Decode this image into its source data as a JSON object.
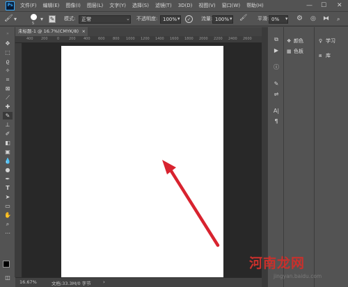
{
  "app": {
    "logo": "Ps"
  },
  "menu": [
    "文件(F)",
    "编辑(E)",
    "图像(I)",
    "图层(L)",
    "文字(Y)",
    "选择(S)",
    "滤镜(T)",
    "3D(D)",
    "视图(V)",
    "窗口(W)",
    "帮助(H)"
  ],
  "window_controls": {
    "minimize": "—",
    "maximize": "☐",
    "close": "✕"
  },
  "options": {
    "brush_size": "5",
    "mode_label": "模式:",
    "mode_value": "正常",
    "opacity_label": "不透明度:",
    "opacity_value": "100%",
    "flow_label": "流量:",
    "flow_value": "100%",
    "smooth_label": "平滑:",
    "smooth_value": "0%"
  },
  "document_tab": {
    "title": "未标题-1 @ 16.7%(CMYK/8)",
    "close": "×"
  },
  "ruler_ticks": [
    "400",
    "200",
    "0",
    "200",
    "400",
    "600",
    "800",
    "1000",
    "1200",
    "1400",
    "1600",
    "1800",
    "2000",
    "2200",
    "2400",
    "2600"
  ],
  "status": {
    "zoom": "16.67%",
    "doc_info": "文档:33.3M/0 字节"
  },
  "panels": {
    "color_label": "颜色",
    "swatches_label": "色板",
    "learn_label": "学习",
    "library_label": "库"
  },
  "watermark": {
    "main": "河南龙网",
    "url": "jingyan.baidu.com"
  },
  "colors": {
    "accent": "#31a8ff",
    "arrow": "#d8232f",
    "workspace": "#282828",
    "ui": "#535353"
  }
}
